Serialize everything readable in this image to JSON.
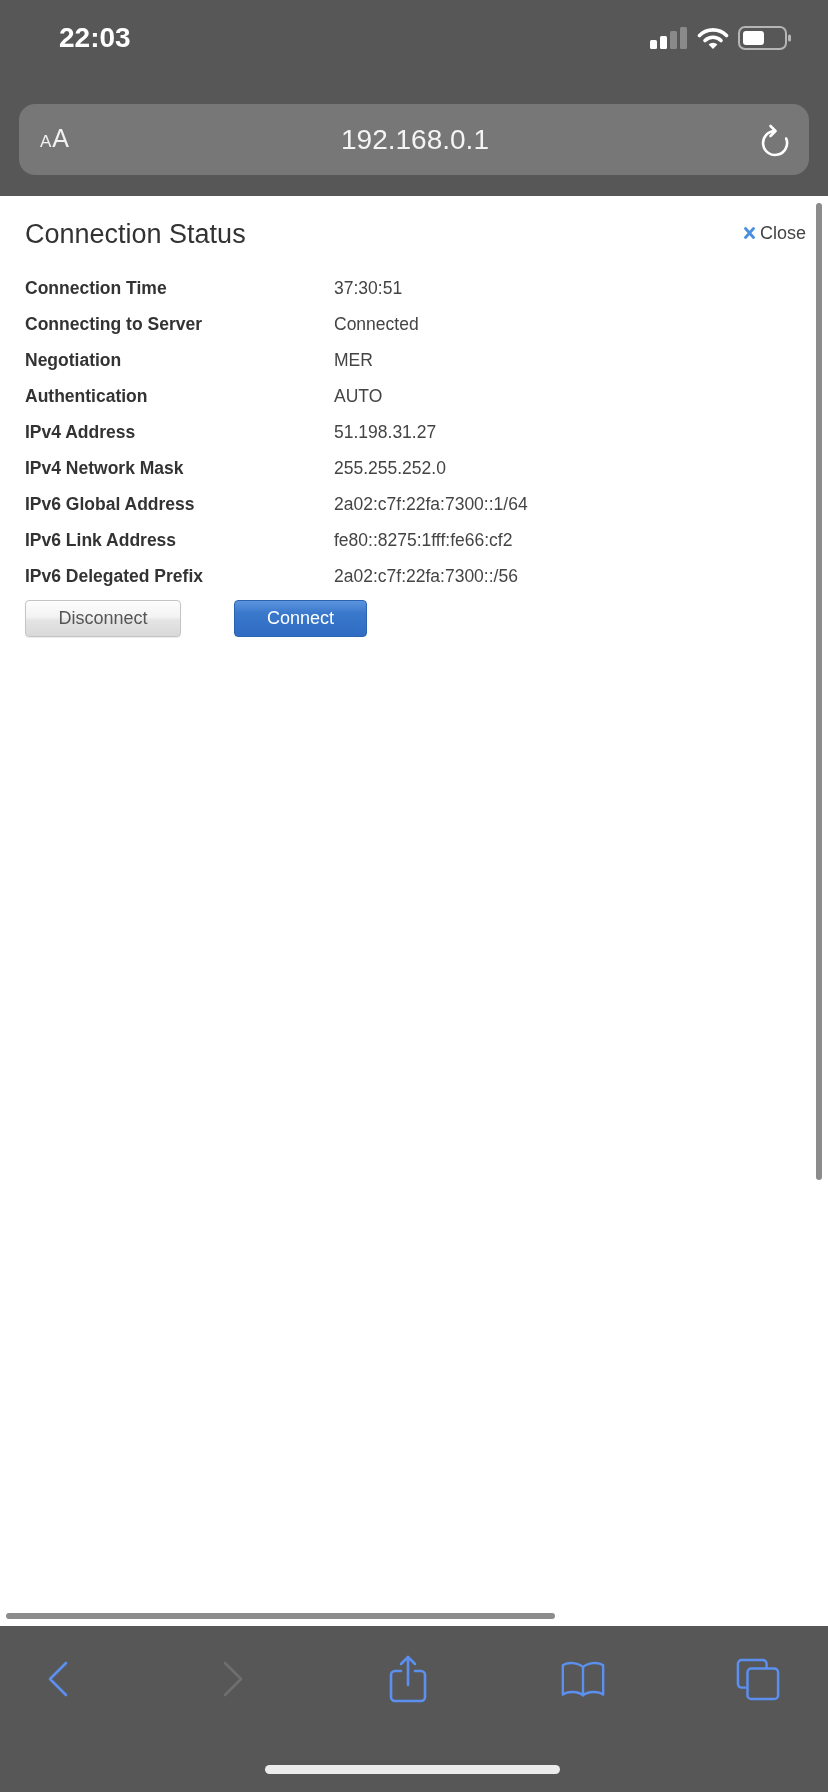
{
  "status_bar": {
    "time": "22:03"
  },
  "address_bar": {
    "text_size_label": "AA",
    "url": "192.168.0.1"
  },
  "panel": {
    "title": "Connection Status",
    "close_label": "Close",
    "rows": [
      {
        "label": "Connection Time",
        "value": "37:30:51"
      },
      {
        "label": "Connecting to Server",
        "value": "Connected"
      },
      {
        "label": "Negotiation",
        "value": "MER"
      },
      {
        "label": "Authentication",
        "value": "AUTO"
      },
      {
        "label": "IPv4 Address",
        "value": "51.198.31.27"
      },
      {
        "label": "IPv4 Network Mask",
        "value": "255.255.252.0"
      },
      {
        "label": "IPv6 Global Address",
        "value": "2a02:c7f:22fa:7300::1/64"
      },
      {
        "label": "IPv6 Link Address",
        "value": "fe80::8275:1fff:fe66:cf2"
      },
      {
        "label": "IPv6 Delegated Prefix",
        "value": "2a02:c7f:22fa:7300::/56"
      }
    ],
    "buttons": [
      {
        "kind": "disconnect",
        "label": "Disconnect"
      },
      {
        "kind": "connect",
        "label": "Connect"
      }
    ]
  },
  "toolbar": {
    "buttons": [
      {
        "kind": "back",
        "disabled": false
      },
      {
        "kind": "forward",
        "disabled": true
      },
      {
        "kind": "share",
        "disabled": false
      },
      {
        "kind": "bookmarks",
        "disabled": false
      },
      {
        "kind": "tabs",
        "disabled": false
      }
    ]
  }
}
